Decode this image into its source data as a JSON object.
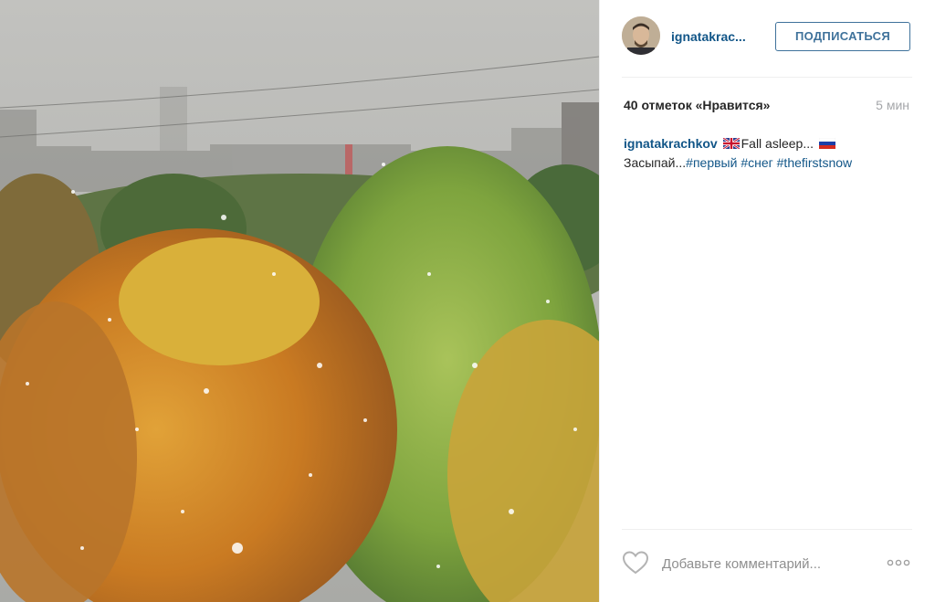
{
  "post": {
    "photo": {
      "alt": "Autumn trees under first snow over a city",
      "colors": {
        "sky": "#b9b9b6",
        "orange_tree": "#d68a24",
        "yellow_tree": "#d4b637",
        "green_tree": "#7ea43e",
        "dark_green": "#4f6b34"
      }
    },
    "author": {
      "username_short": "ignatakrac...",
      "avatar_icon": "avatar"
    },
    "follow_button": {
      "label": "ПОДПИСАТЬСЯ",
      "color": "#3f729b"
    },
    "likes_text": "40 отметок «Нравится»",
    "time_ago": "5 мин",
    "caption": {
      "username": "ignatakrachkov",
      "flag_uk_icon": "flag-uk-icon",
      "text_en": "Fall asleep...",
      "flag_ru_icon": "flag-ru-icon",
      "text_ru": "Засыпай...",
      "hashtags": [
        "#первый",
        "#снег",
        "#thefirstsnow"
      ]
    },
    "comment": {
      "placeholder": "Добавьте комментарий...",
      "like_icon": "heart-outline-icon",
      "more_icon": "more-options-icon"
    },
    "colors": {
      "link": "#125688",
      "text": "#262626",
      "muted": "#a5a7aa",
      "divider": "#efefef"
    }
  }
}
